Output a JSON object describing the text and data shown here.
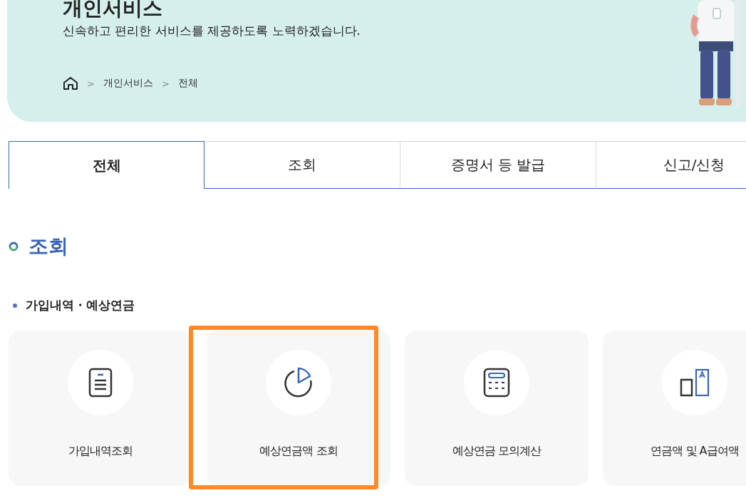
{
  "banner": {
    "title": "개인서비스",
    "subtitle": "신속하고 편리한 서비스를 제공하도록 노력하겠습니다.",
    "breadcrumb": [
      "개인서비스",
      "전체"
    ],
    "separator": ">"
  },
  "tabs": [
    {
      "label": "전체",
      "selected": true
    },
    {
      "label": "조회",
      "selected": false
    },
    {
      "label": "증명서 등 발급",
      "selected": false
    },
    {
      "label": "신고/신청",
      "selected": false
    }
  ],
  "section": {
    "title": "조회",
    "group": "가입내역・예상연금",
    "cards": [
      {
        "label": "가입내역조회",
        "highlighted": false
      },
      {
        "label": "예상연금액 조회",
        "highlighted": true
      },
      {
        "label": "예상연금 모의계산",
        "highlighted": false
      },
      {
        "label": "연금액 및 A급여액",
        "highlighted": false
      }
    ]
  }
}
